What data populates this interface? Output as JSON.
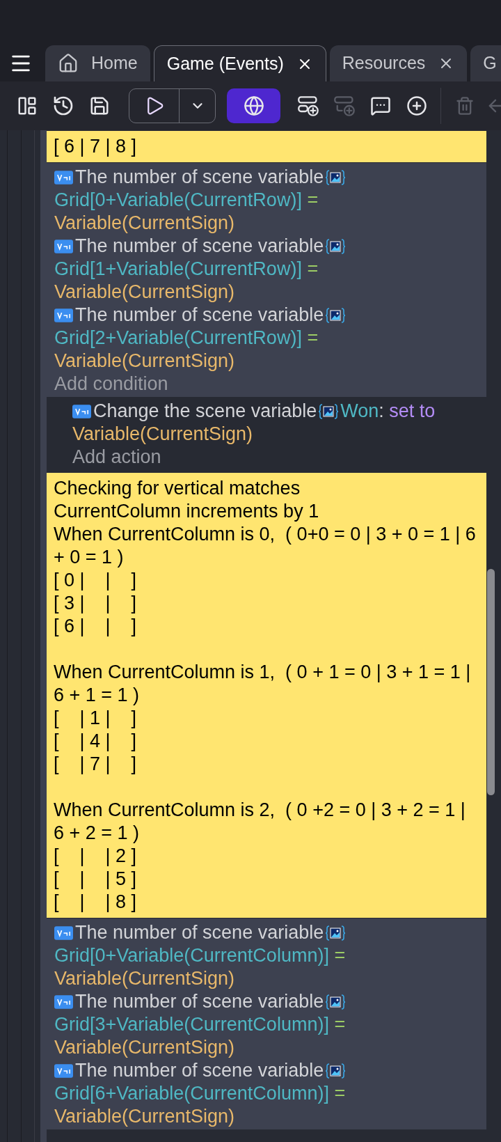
{
  "tabs": [
    {
      "kind": "home",
      "label": "Home",
      "selected": false,
      "closable": false
    },
    {
      "kind": "document",
      "label": "Game (Events)",
      "selected": true,
      "closable": true
    },
    {
      "kind": "document",
      "label": "Resources",
      "selected": false,
      "closable": true
    },
    {
      "kind": "document",
      "label": "G",
      "selected": false,
      "closable": false
    }
  ],
  "toolbar": [
    {
      "kind": "layout",
      "disabled": false
    },
    {
      "kind": "history",
      "disabled": false
    },
    {
      "kind": "save",
      "disabled": false
    },
    {
      "kind": "preview",
      "disabled": false
    },
    {
      "kind": "network",
      "disabled": false
    },
    {
      "kind": "add-event",
      "disabled": false
    },
    {
      "kind": "add-subevent",
      "disabled": true
    },
    {
      "kind": "add-comment",
      "disabled": false
    },
    {
      "kind": "add",
      "disabled": false
    },
    {
      "kind": "separator",
      "disabled": false
    },
    {
      "kind": "delete",
      "disabled": true
    },
    {
      "kind": "back",
      "disabled": true
    }
  ],
  "events": [
    {
      "kind": "comment",
      "text": "[ 6 | 7 | 8 ]"
    },
    {
      "kind": "conditions",
      "items": [
        {
          "text": "The number of scene variable",
          "variable": "Grid[0+Variable(CurrentRow)]",
          "operator": "=",
          "value": "Variable(CurrentSign)"
        },
        {
          "text": "The number of scene variable",
          "variable": "Grid[1+Variable(CurrentRow)]",
          "operator": "=",
          "value": "Variable(CurrentSign)"
        },
        {
          "text": "The number of scene variable",
          "variable": "Grid[2+Variable(CurrentRow)]",
          "operator": "=",
          "value": "Variable(CurrentSign)"
        }
      ],
      "add_label": "Add condition"
    },
    {
      "kind": "actions",
      "items": [
        {
          "text": "Change the scene variable",
          "variable": "Won",
          "separator": ":",
          "operation": "set to",
          "value": "Variable(CurrentSign)"
        }
      ],
      "add_label": "Add action"
    },
    {
      "kind": "comment",
      "text": "Checking for vertical matches\nCurrentColumn increments by 1\nWhen CurrentColumn is 0,  ( 0+0 = 0 | 3 + 0 = 1 | 6 + 0 = 1 )\n[ 0 |    |    ]\n[ 3 |    |    ]\n[ 6 |    |    ]\n\nWhen CurrentColumn is 1,  ( 0 + 1 = 0 | 3 + 1 = 1 | 6 + 1 = 1 )\n[    | 1 |    ]\n[    | 4 |    ]\n[    | 7 |    ]\n\nWhen CurrentColumn is 2,  ( 0 +2 = 0 | 3 + 2 = 1 | 6 + 2 = 1 )\n[    |    | 2 ]\n[    |    | 5 ]\n[    |    | 8 ]"
    },
    {
      "kind": "conditions",
      "items": [
        {
          "text": "The number of scene variable",
          "variable": "Grid[0+Variable(CurrentColumn)]",
          "operator": "=",
          "value": "Variable(CurrentSign)"
        },
        {
          "text": "The number of scene variable",
          "variable": "Grid[3+Variable(CurrentColumn)]",
          "operator": "=",
          "value": "Variable(CurrentSign)"
        },
        {
          "text": "The number of scene variable",
          "variable": "Grid[6+Variable(CurrentColumn)]",
          "operator": "=",
          "value": "Variable(CurrentSign)"
        }
      ]
    }
  ]
}
